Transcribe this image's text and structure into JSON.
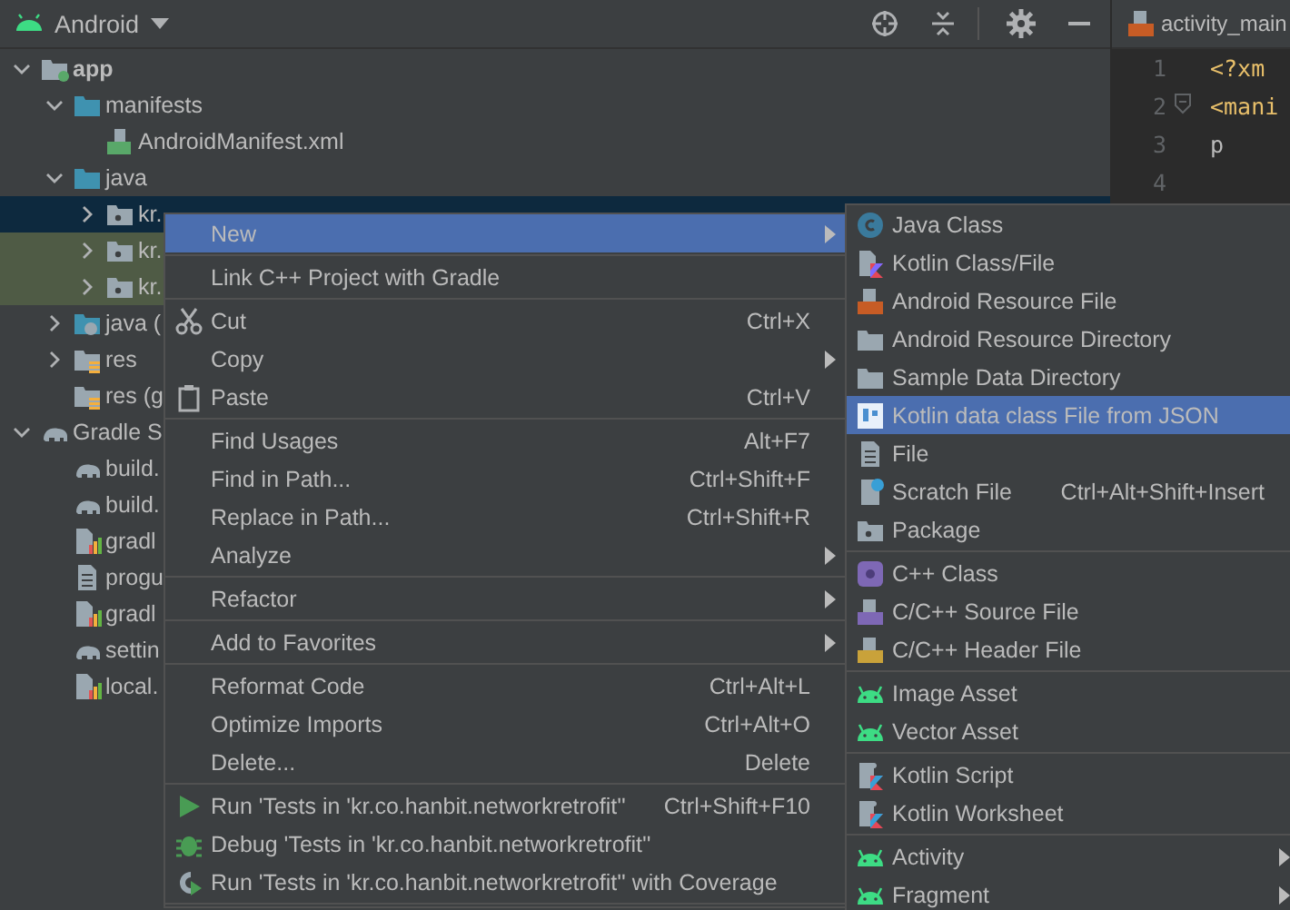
{
  "panel": {
    "title": "Android"
  },
  "tree": [
    {
      "label": "app",
      "kind": "module",
      "expanded": true,
      "selected": false,
      "test": false,
      "children": [
        {
          "label": "manifests",
          "kind": "source-folder",
          "expanded": true,
          "selected": false,
          "test": false,
          "children": [
            {
              "label": "AndroidManifest.xml",
              "kind": "manifest",
              "selected": false,
              "test": false
            }
          ]
        },
        {
          "label": "java",
          "kind": "source-folder",
          "expanded": true,
          "selected": false,
          "test": false,
          "children": [
            {
              "label": "kr.",
              "kind": "package",
              "expanded": false,
              "selected": true,
              "test": false
            },
            {
              "label": "kr.",
              "kind": "package",
              "expanded": false,
              "selected": false,
              "test": true
            },
            {
              "label": "kr.",
              "kind": "package",
              "expanded": false,
              "selected": false,
              "test": true
            }
          ]
        },
        {
          "label": "java (",
          "kind": "generated-folder",
          "expanded": false,
          "selected": false,
          "test": false
        },
        {
          "label": "res",
          "kind": "res-folder",
          "expanded": false,
          "selected": false,
          "test": false
        },
        {
          "label": "res (g",
          "kind": "res-folder",
          "selected": false,
          "test": false
        }
      ]
    },
    {
      "label": "Gradle S",
      "kind": "gradle",
      "expanded": true,
      "selected": false,
      "test": false,
      "children": [
        {
          "label": "build.",
          "kind": "gradle",
          "selected": false,
          "test": false
        },
        {
          "label": "build.",
          "kind": "gradle",
          "selected": false,
          "test": false
        },
        {
          "label": "gradl",
          "kind": "properties",
          "selected": false,
          "test": false
        },
        {
          "label": "progu",
          "kind": "text",
          "selected": false,
          "test": false
        },
        {
          "label": "gradl",
          "kind": "properties",
          "selected": false,
          "test": false
        },
        {
          "label": "settin",
          "kind": "gradle",
          "selected": false,
          "test": false
        },
        {
          "label": "local.",
          "kind": "properties",
          "selected": false,
          "test": false
        }
      ]
    }
  ],
  "editor": {
    "tab": "activity_main",
    "lines": [
      {
        "number": "1",
        "code": "<?xm",
        "kind": "tag",
        "fold": false
      },
      {
        "number": "2",
        "code": "<mani",
        "kind": "tag",
        "fold": true
      },
      {
        "number": "3",
        "code": "p",
        "kind": "attribute",
        "fold": false
      },
      {
        "number": "4",
        "fold": false
      }
    ]
  },
  "menu": [
    {
      "kind": "plain",
      "label": "New",
      "submenu": true,
      "selected": true
    },
    {
      "kind": "separator"
    },
    {
      "kind": "plain",
      "label": "Link C++ Project with Gradle",
      "submenu": false,
      "selected": false
    },
    {
      "kind": "separator"
    },
    {
      "kind": "cut",
      "label": "Cut",
      "shortcut": "Ctrl+X",
      "submenu": false,
      "selected": false
    },
    {
      "kind": "plain",
      "label": "Copy",
      "submenu": true,
      "selected": false
    },
    {
      "kind": "paste",
      "label": "Paste",
      "shortcut": "Ctrl+V",
      "submenu": false,
      "selected": false
    },
    {
      "kind": "separator"
    },
    {
      "kind": "plain",
      "label": "Find Usages",
      "shortcut": "Alt+F7",
      "submenu": false,
      "selected": false
    },
    {
      "kind": "plain",
      "label": "Find in Path...",
      "shortcut": "Ctrl+Shift+F",
      "submenu": false,
      "selected": false
    },
    {
      "kind": "plain",
      "label": "Replace in Path...",
      "shortcut": "Ctrl+Shift+R",
      "submenu": false,
      "selected": false
    },
    {
      "kind": "plain",
      "label": "Analyze",
      "submenu": true,
      "selected": false
    },
    {
      "kind": "separator"
    },
    {
      "kind": "plain",
      "label": "Refactor",
      "submenu": true,
      "selected": false
    },
    {
      "kind": "separator"
    },
    {
      "kind": "plain",
      "label": "Add to Favorites",
      "submenu": true,
      "selected": false
    },
    {
      "kind": "separator"
    },
    {
      "kind": "plain",
      "label": "Reformat Code",
      "shortcut": "Ctrl+Alt+L",
      "submenu": false,
      "selected": false
    },
    {
      "kind": "plain",
      "label": "Optimize Imports",
      "shortcut": "Ctrl+Alt+O",
      "submenu": false,
      "selected": false
    },
    {
      "kind": "plain",
      "label": "Delete...",
      "shortcut": "Delete",
      "submenu": false,
      "selected": false
    },
    {
      "kind": "separator"
    },
    {
      "kind": "run",
      "label": "Run 'Tests in 'kr.co.hanbit.networkretrofit''",
      "shortcut": "Ctrl+Shift+F10",
      "submenu": false,
      "selected": false
    },
    {
      "kind": "debug",
      "label": "Debug 'Tests in 'kr.co.hanbit.networkretrofit''",
      "submenu": false,
      "selected": false
    },
    {
      "kind": "coverage",
      "label": "Run 'Tests in 'kr.co.hanbit.networkretrofit'' with Coverage",
      "submenu": false,
      "selected": false
    },
    {
      "kind": "separator"
    }
  ],
  "submenu": [
    {
      "kind": "java-class",
      "label": "Java Class",
      "submenu": false,
      "selected": false
    },
    {
      "kind": "kotlin-file",
      "label": "Kotlin Class/File",
      "submenu": false,
      "selected": false
    },
    {
      "kind": "xml-file",
      "label": "Android Resource File",
      "submenu": false,
      "selected": false
    },
    {
      "kind": "folder",
      "label": "Android Resource Directory",
      "submenu": false,
      "selected": false
    },
    {
      "kind": "folder",
      "label": "Sample Data Directory",
      "submenu": false,
      "selected": false
    },
    {
      "kind": "json",
      "label": "Kotlin data class File from JSON",
      "submenu": false,
      "selected": true
    },
    {
      "kind": "text",
      "label": "File",
      "submenu": false,
      "selected": false
    },
    {
      "kind": "scratch",
      "label": "Scratch File",
      "shortcut": "Ctrl+Alt+Shift+Insert",
      "submenu": false,
      "selected": false
    },
    {
      "kind": "package",
      "label": "Package",
      "submenu": false,
      "selected": false
    },
    {
      "kind": "separator"
    },
    {
      "kind": "cpp-class",
      "label": "C++ Class",
      "submenu": false,
      "selected": false
    },
    {
      "kind": "cpp-source",
      "label": "C/C++ Source File",
      "submenu": false,
      "selected": false
    },
    {
      "kind": "cpp-header",
      "label": "C/C++ Header File",
      "submenu": false,
      "selected": false
    },
    {
      "kind": "separator"
    },
    {
      "kind": "android",
      "label": "Image Asset",
      "submenu": false,
      "selected": false
    },
    {
      "kind": "android",
      "label": "Vector Asset",
      "submenu": false,
      "selected": false
    },
    {
      "kind": "separator"
    },
    {
      "kind": "kotlin-script",
      "label": "Kotlin Script",
      "submenu": false,
      "selected": false
    },
    {
      "kind": "kotlin-script",
      "label": "Kotlin Worksheet",
      "submenu": false,
      "selected": false
    },
    {
      "kind": "separator"
    },
    {
      "kind": "android",
      "label": "Activity",
      "submenu": true,
      "selected": false
    },
    {
      "kind": "android",
      "label": "Fragment",
      "submenu": true,
      "selected": false
    }
  ]
}
